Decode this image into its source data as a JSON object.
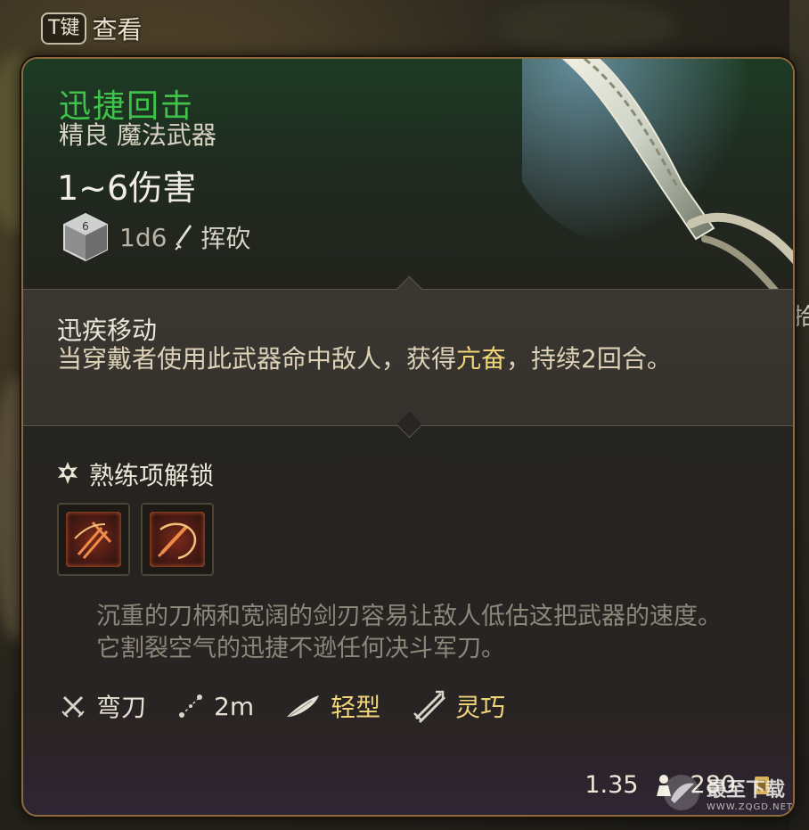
{
  "hint": {
    "key": "T键",
    "label": "查看"
  },
  "edge_text": "拾",
  "item": {
    "name": "迅捷回击",
    "rarity": "精良 魔法武器",
    "damage": "1~6伤害",
    "dice": "1d6",
    "damage_type": "挥砍"
  },
  "passive": {
    "title": "迅疾移动",
    "desc_before": "当穿戴者使用此武器命中敌人，获得",
    "desc_highlight": "亢奋",
    "desc_after": "，持续2回合。"
  },
  "proficiency": {
    "title": "熟练项解锁",
    "actions": [
      "action-slot-1",
      "action-slot-2"
    ]
  },
  "flavor": "沉重的刀柄和宽阔的剑刃容易让敌人低估这把武器的速度。它割裂空气的迅捷不逊任何决斗军刀。",
  "properties": [
    {
      "icon": "crossed-swords-icon",
      "label": "弯刀",
      "gold": false
    },
    {
      "icon": "range-icon",
      "label": "2m",
      "gold": false
    },
    {
      "icon": "feather-icon",
      "label": "轻型",
      "gold": true
    },
    {
      "icon": "finesse-icon",
      "label": "灵巧",
      "gold": true
    }
  ],
  "footer": {
    "weight": "1.35",
    "value": "280"
  },
  "watermark": {
    "name": "最至下载",
    "url": "WWW.ZQGD.NET"
  },
  "colors": {
    "name_green": "#3fc24a",
    "highlight_gold": "#f2d77a",
    "border": "#8a6a3e"
  }
}
